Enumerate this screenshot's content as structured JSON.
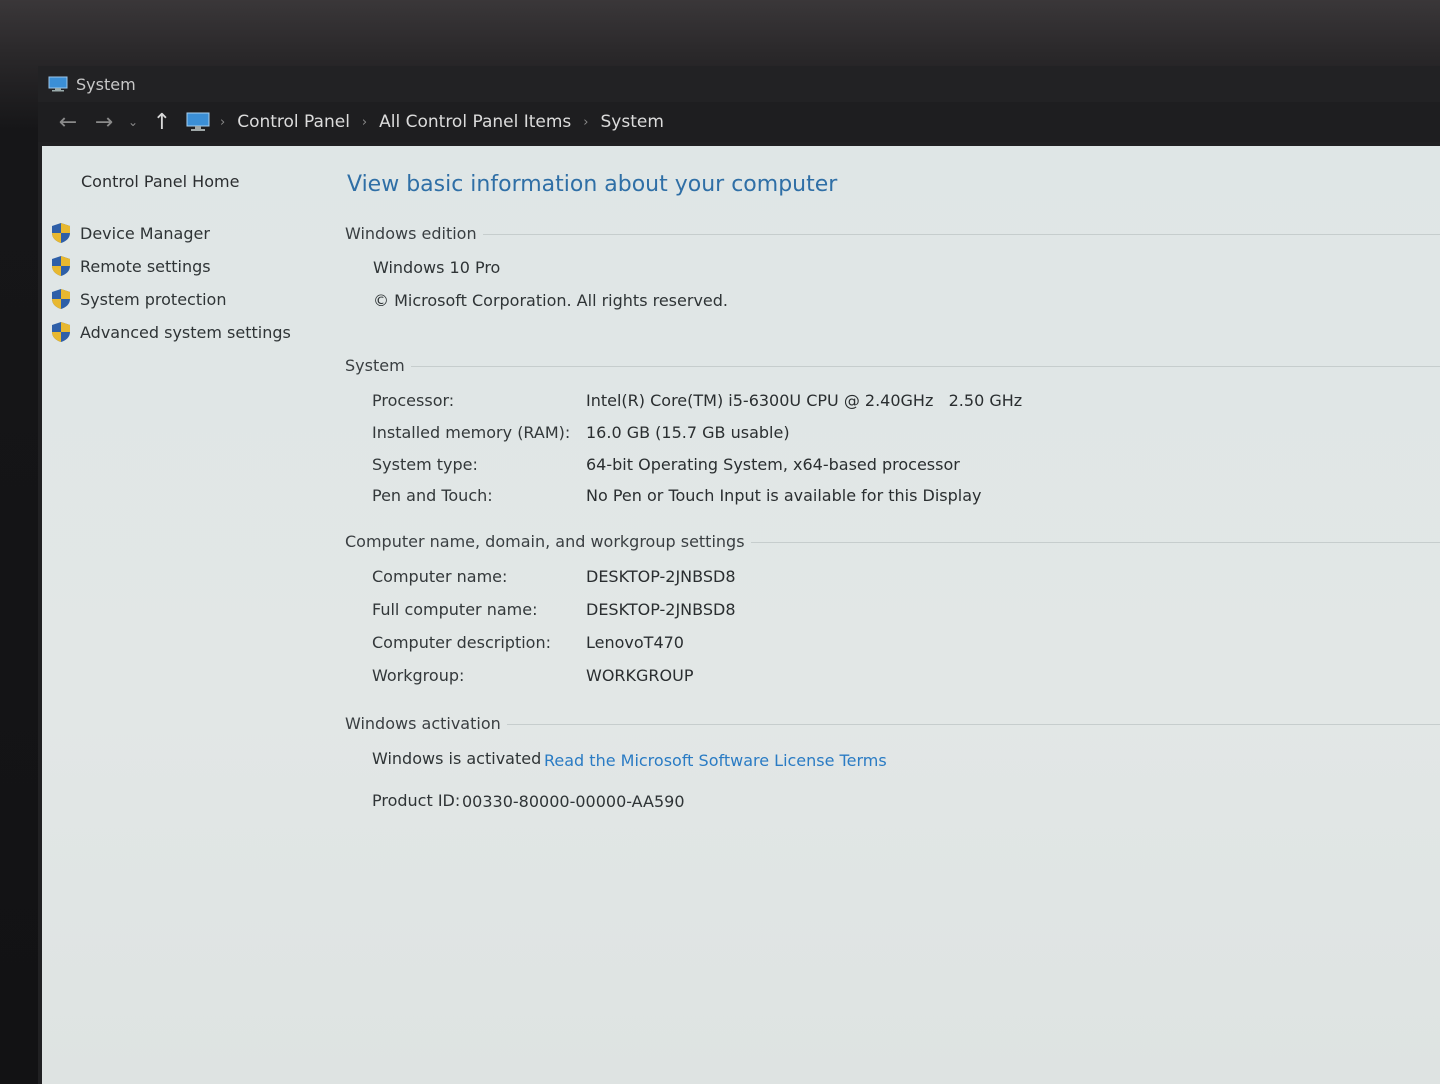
{
  "window": {
    "title": "System"
  },
  "address": {
    "crumbs": [
      "Control Panel",
      "All Control Panel Items",
      "System"
    ]
  },
  "sidebar": {
    "home": "Control Panel Home",
    "links": [
      "Device Manager",
      "Remote settings",
      "System protection",
      "Advanced system settings"
    ]
  },
  "main": {
    "title": "View basic information about your computer",
    "edition": {
      "heading": "Windows edition",
      "name": "Windows 10 Pro",
      "copyright": "© Microsoft Corporation. All rights reserved."
    },
    "system": {
      "heading": "System",
      "rows": [
        {
          "label": "Processor:",
          "value": "Intel(R) Core(TM) i5-6300U CPU @ 2.40GHz   2.50 GHz"
        },
        {
          "label": "Installed memory (RAM):",
          "value": "16.0 GB (15.7 GB usable)"
        },
        {
          "label": "System type:",
          "value": "64-bit Operating System, x64-based processor"
        },
        {
          "label": "Pen and Touch:",
          "value": "No Pen or Touch Input is available for this Display"
        }
      ]
    },
    "computer_name": {
      "heading": "Computer name, domain, and workgroup settings",
      "rows": [
        {
          "label": "Computer name:",
          "value": "DESKTOP-2JNBSD8"
        },
        {
          "label": "Full computer name:",
          "value": "DESKTOP-2JNBSD8"
        },
        {
          "label": "Computer description:",
          "value": "LenovoT470"
        },
        {
          "label": "Workgroup:",
          "value": "WORKGROUP"
        }
      ]
    },
    "activation": {
      "heading": "Windows activation",
      "status": "Windows is activated",
      "license_link": "Read the Microsoft Software License Terms",
      "product_id_label": "Product ID:",
      "product_id": "00330-80000-00000-AA590"
    }
  },
  "colors": {
    "title_blue": "#2f6fa6",
    "link_blue": "#2a7bc4",
    "shield_blue": "#2e5fa8",
    "shield_yellow": "#e8b830"
  }
}
